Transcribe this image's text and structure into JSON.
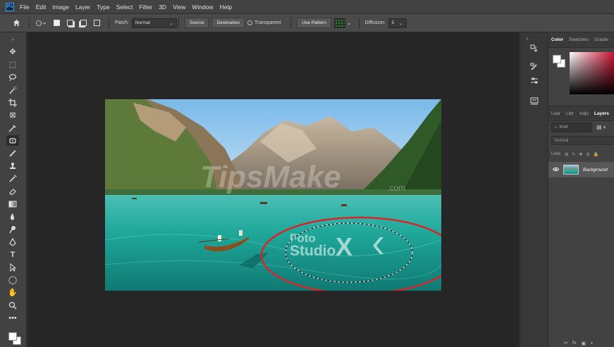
{
  "app": {
    "logo": "Ps"
  },
  "menu": [
    "File",
    "Edit",
    "Image",
    "Layer",
    "Type",
    "Select",
    "Filter",
    "3D",
    "View",
    "Window",
    "Help"
  ],
  "options": {
    "patch_label": "Patch:",
    "patch_value": "Normal",
    "source_label": "Source",
    "destination_label": "Destination",
    "transparent_label": "Transparent",
    "use_pattern_label": "Use Pattern",
    "diffusion_label": "Diffusion:",
    "diffusion_value": "5"
  },
  "panels": {
    "color_tabs": [
      "Color",
      "Swatches",
      "Gradie"
    ],
    "layer_tabs": [
      "Lear",
      "Libr",
      "Adju",
      "Layers"
    ],
    "search_placeholder": "Kind",
    "blend_mode": "Normal",
    "lock_label": "Lock:",
    "layer_name": "Background"
  },
  "canvas": {
    "watermark_text": "TipsMake",
    "watermark_suffix": ".com",
    "logo_line1": "Foto",
    "logo_line2": "Studio",
    "logo_mark": "X"
  },
  "icons": {
    "tools": [
      "move-icon",
      "marquee-icon",
      "lasso-icon",
      "quick-select-icon",
      "crop-icon",
      "frame-icon",
      "eyedropper-icon",
      "patch-tool-icon",
      "brush-icon",
      "clone-stamp-icon",
      "history-brush-icon",
      "eraser-icon",
      "gradient-icon",
      "blur-icon",
      "dodge-icon",
      "pen-icon",
      "type-icon",
      "path-select-icon",
      "ellipse-icon",
      "hand-icon",
      "zoom-icon",
      "more-tools-icon"
    ]
  },
  "colors": {
    "selection_ellipse": "#d6262a",
    "water": "#1fa79a",
    "sky": "#8fc4ee"
  }
}
